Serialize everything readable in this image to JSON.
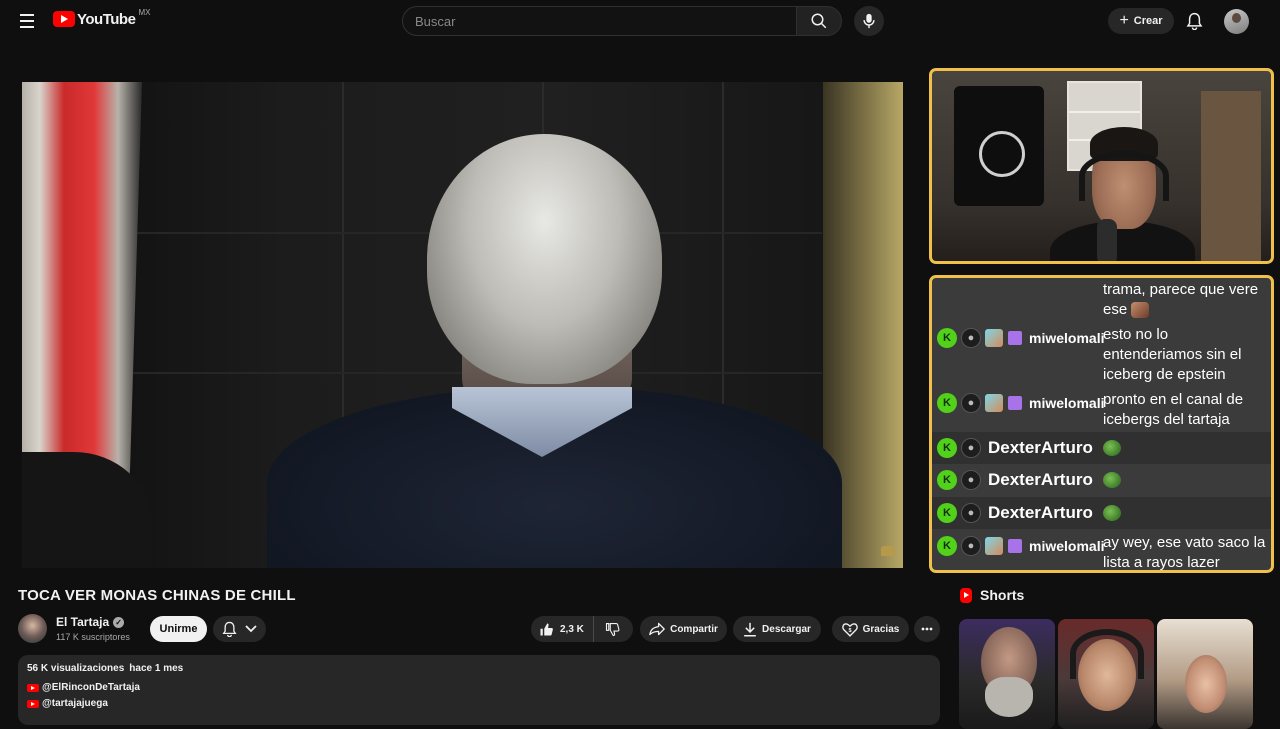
{
  "header": {
    "logo_text": "YouTube",
    "country": "MX",
    "search_placeholder": "Buscar",
    "create_label": "Crear"
  },
  "video": {
    "title": "TOCA VER MONAS CHINAS DE CHILL"
  },
  "channel": {
    "name": "El Tartaja",
    "subscribers": "117 K suscriptores",
    "join_label": "Unirme"
  },
  "actions": {
    "likes": "2,3 K",
    "share_label": "Compartir",
    "download_label": "Descargar",
    "thanks_label": "Gracias"
  },
  "description": {
    "views": "56 K visualizaciones",
    "age": "hace 1 mes",
    "links": [
      "@ElRinconDeTartaja",
      "@tartajajuega"
    ]
  },
  "chat": {
    "messages": [
      {
        "user": "",
        "text_lines": [
          "trama, parece que vere",
          "ese"
        ]
      },
      {
        "user": "miwelomali",
        "text_lines": [
          "esto no lo",
          "entenderiamos sin el",
          "iceberg de epstein"
        ]
      },
      {
        "user": "miwelomali",
        "text_lines": [
          "pronto en el canal de",
          "icebergs del tartaja"
        ]
      },
      {
        "user": "DexterArturo",
        "text_lines": []
      },
      {
        "user": "DexterArturo",
        "text_lines": []
      },
      {
        "user": "DexterArturo",
        "text_lines": []
      },
      {
        "user": "miwelomali",
        "text_lines": [
          "ay wey, ese vato saco la",
          "lista a rayos lazer"
        ]
      }
    ]
  },
  "shorts": {
    "title": "Shorts"
  },
  "colors": {
    "accent_border": "#f0c04a",
    "brand_red": "#ff0000",
    "kick_green": "#52d11a"
  }
}
